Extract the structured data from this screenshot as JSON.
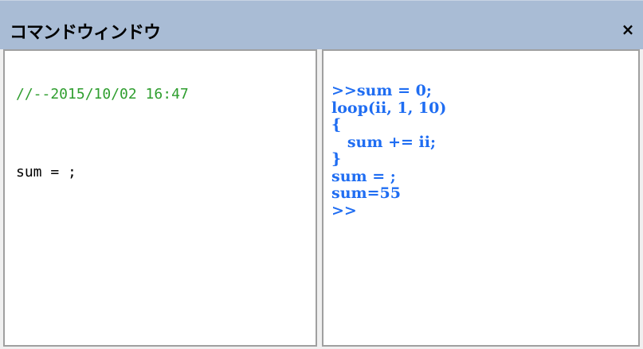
{
  "window": {
    "title": "コマンドウィンドウ",
    "close_label": "×"
  },
  "editor": {
    "comment_line": "//--2015/10/02 16:47",
    "code_line": "sum = ;"
  },
  "console": {
    "lines": [
      ">>sum = 0;",
      "loop(ii, 1, 10)",
      "{",
      "   sum += ii;",
      "}",
      "sum = ;",
      "sum=55",
      ">>"
    ]
  },
  "colors": {
    "titlebar": "#a9bcd5",
    "comment": "#2f9e2f",
    "console_text": "#1f6df2"
  }
}
